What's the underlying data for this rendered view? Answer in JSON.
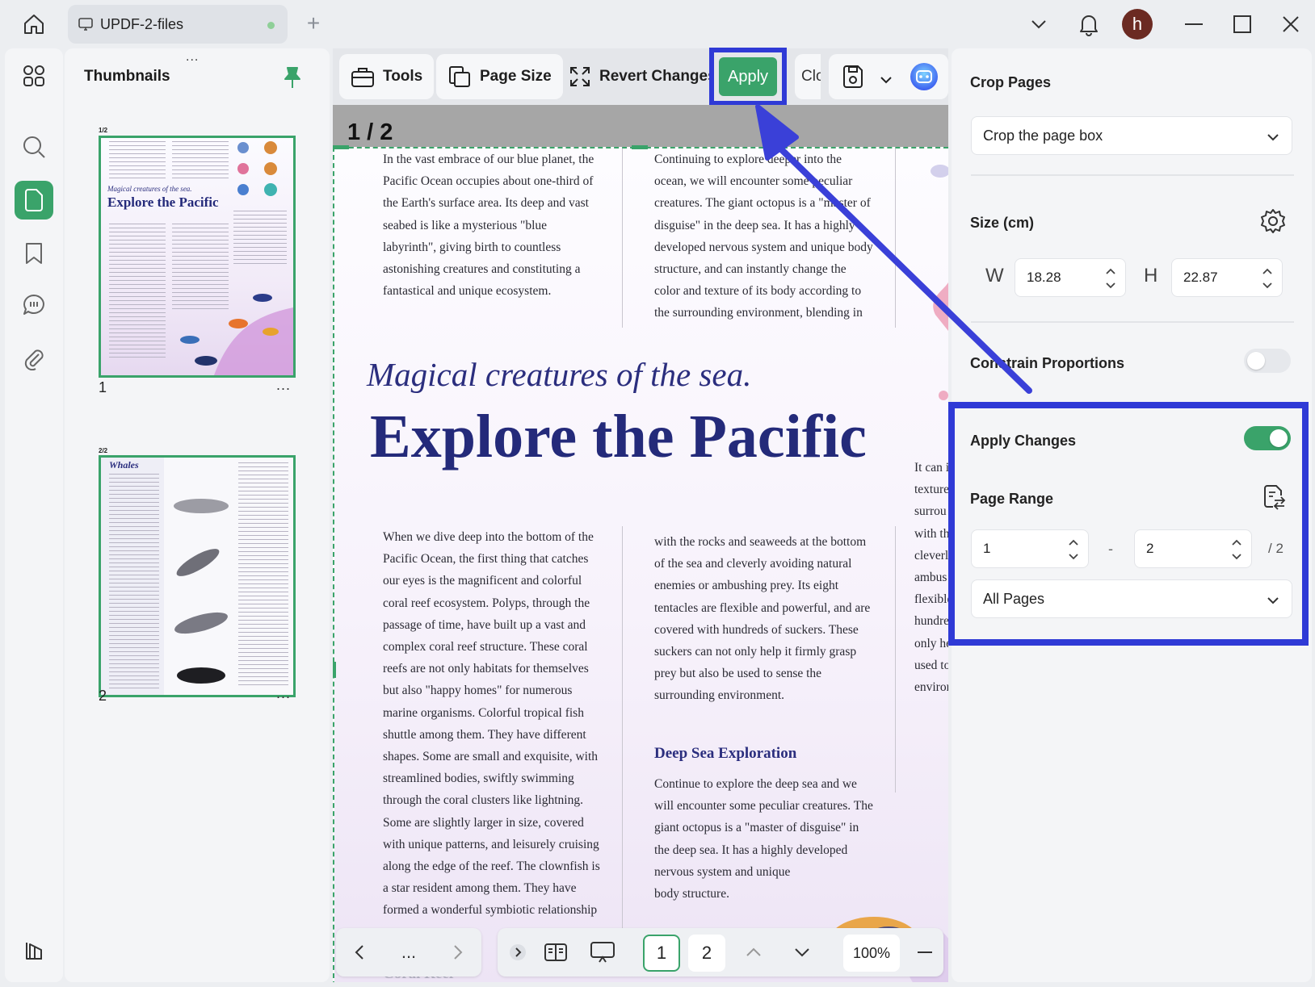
{
  "titlebar": {
    "tab_label": "UPDF-2-files",
    "new_tab_symbol": "+",
    "avatar_initial": "h"
  },
  "rail": {
    "items": [
      "grid-icon",
      "search-icon",
      "page-organize-icon",
      "bookmark-icon",
      "comment-icon",
      "attachment-icon",
      "layers-icon"
    ],
    "active": "page-organize-icon"
  },
  "thumbnails": {
    "title": "Thumbnails",
    "grip": "...",
    "pages": [
      {
        "number": "1",
        "badge": "1/2",
        "heading_small": "Magical creatures of the sea.",
        "heading_big": "Explore the Pacific"
      },
      {
        "number": "2",
        "badge": "2/2",
        "heading_small": "Whales"
      }
    ],
    "more": "..."
  },
  "toolbar": {
    "tools": "Tools",
    "page_size": "Page Size",
    "revert": "Revert Changes",
    "apply": "Apply",
    "close_partial": "Clos"
  },
  "document": {
    "page_indicator": "1 / 2",
    "col1_top": "In the vast embrace of our blue planet, the\nPacific Ocean occupies about one-third of\nthe Earth's surface area. Its deep and vast\nseabed is like a mysterious \"blue\nlabyrinth\", giving birth to countless\nastonishing creatures and constituting a\nfantastical and unique ecosystem.",
    "col2_top": "Continuing to explore deeper into the\nocean, we will encounter some peculiar\ncreatures. The giant octopus is a \"master of\ndisguise\" in the deep sea. It has a highly\ndeveloped nervous system and unique body\nstructure, and can instantly change the\ncolor and texture of its body according to\nthe surrounding environment, blending in",
    "magical": "Magical creatures of the sea.",
    "explore": "Explore the Pacific",
    "col1_bottom": "When we dive deep into the bottom of the\nPacific Ocean, the first thing that catches\nour eyes is the magnificent and colorful\ncoral reef ecosystem. Polyps, through the\npassage of time, have built up a vast and\ncomplex coral reef structure. These coral\nreefs are not only habitats for themselves\nbut also \"happy homes\" for numerous\nmarine organisms. Colorful tropical fish\nshuttle among them. They have different\nshapes. Some are small and exquisite, with\nstreamlined bodies, swiftly swimming\nthrough the coral clusters like lightning.\nSome are slightly larger in size, covered\nwith unique patterns, and leisurely cruising\nalong the edge of the reef. The clownfish is\na star resident among them. They have\nformed a wonderful symbiotic relationship",
    "col2_bottom": "with the rocks and seaweeds at the bottom\nof the sea and cleverly avoiding natural\nenemies or ambushing prey. Its eight\ntentacles are flexible and powerful, and are\ncovered with hundreds of suckers. These\nsuckers can not only help it firmly grasp\nprey but also be used to sense the\nsurrounding environment.",
    "deep_sea_heading": "Deep Sea Exploration",
    "deep_sea_text": "Continue to explore the deep sea and we\nwill encounter some peculiar creatures. The\ngiant octopus is a \"master of disguise\" in\nthe deep sea. It has a highly developed\nnervous system and unique\nbody structure.",
    "col3_partial": "It can i\ntexture\nsurrou\nwith th\ncleverl\nambus\nflexible\nhundre\nonly he\nused to\nenviror",
    "coral_reef_partial": "Coral Reef"
  },
  "bottom_nav": {
    "more": "...",
    "page1": "1",
    "page2": "2",
    "zoom": "100%"
  },
  "right_panel": {
    "crop_pages_label": "Crop Pages",
    "crop_mode": "Crop the page box",
    "size_label": "Size (cm)",
    "w_letter": "W",
    "h_letter": "H",
    "width_value": "18.28",
    "height_value": "22.87",
    "constrain_label": "Constrain Proportions",
    "constrain_on": false,
    "apply_changes_label": "Apply Changes",
    "apply_changes_on": true,
    "page_range_label": "Page Range",
    "range_from": "1",
    "range_dash": "-",
    "range_to": "2",
    "range_total": "/ 2",
    "range_scope": "All Pages"
  },
  "colors": {
    "accent_green": "#3aa36a",
    "annotation_blue": "#2f3ad6",
    "heading_navy": "#242a7a"
  }
}
